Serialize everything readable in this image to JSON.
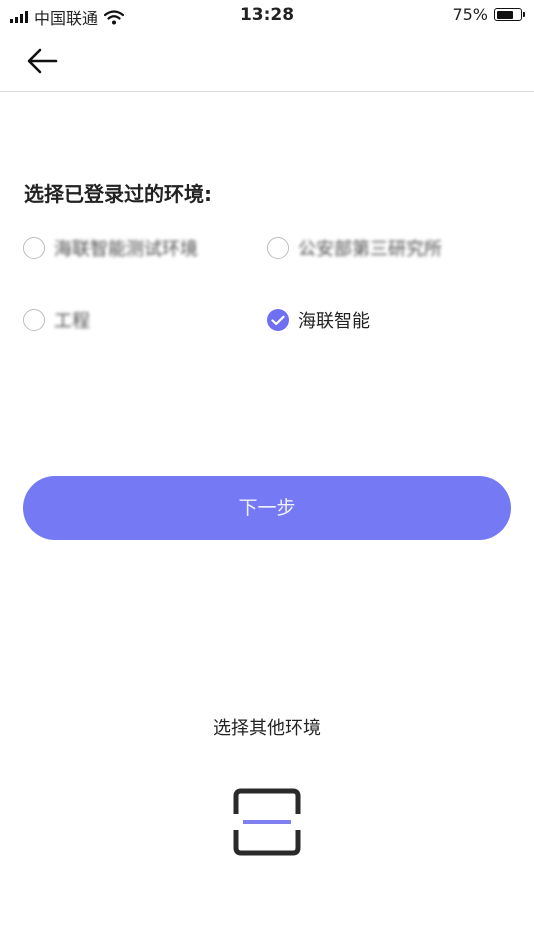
{
  "status_bar": {
    "carrier": "中国联通",
    "time": "13:28",
    "battery_percent": "75%",
    "battery_level": 0.75
  },
  "nav": {
    "back_icon": "arrow-left-icon"
  },
  "section_title": "选择已登录过的环境:",
  "environments": [
    {
      "label": "海联智能测试环境",
      "checked": false,
      "obscured": true
    },
    {
      "label": "公安部第三研究所",
      "checked": false,
      "obscured": true
    },
    {
      "label": "工程",
      "checked": false,
      "obscured": true
    },
    {
      "label": "海联智能",
      "checked": true,
      "obscured": false
    }
  ],
  "next_button": "下一步",
  "other_env_label": "选择其他环境",
  "scan_icon": "scan-icon",
  "colors": {
    "accent": "#7579f3",
    "checked": "#6f6ff2",
    "scan_line": "#7f7ff0"
  }
}
